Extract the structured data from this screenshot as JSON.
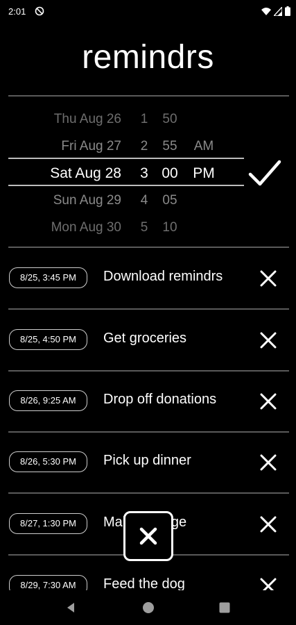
{
  "status_bar": {
    "time": "2:01",
    "icons": [
      "dnd-icon",
      "wifi-icon",
      "signal-icon",
      "battery-icon"
    ]
  },
  "app": {
    "title": "remindrs"
  },
  "picker": {
    "rows": [
      {
        "date": "Thu Aug 26",
        "hour": "1",
        "minute": "50",
        "ampm": ""
      },
      {
        "date": "Fri Aug 27",
        "hour": "2",
        "minute": "55",
        "ampm": "AM"
      },
      {
        "date": "Sat Aug 28",
        "hour": "3",
        "minute": "00",
        "ampm": "PM"
      },
      {
        "date": "Sun Aug 29",
        "hour": "4",
        "minute": "05",
        "ampm": ""
      },
      {
        "date": "Mon Aug 30",
        "hour": "5",
        "minute": "10",
        "ampm": ""
      }
    ],
    "confirm_icon": "check-icon"
  },
  "reminders": [
    {
      "time": "8/25, 3:45 PM",
      "text": "Download remindrs"
    },
    {
      "time": "8/25, 4:50 PM",
      "text": "Get groceries"
    },
    {
      "time": "8/26, 9:25 AM",
      "text": "Drop off donations"
    },
    {
      "time": "8/26, 5:30 PM",
      "text": "Pick up dinner"
    },
    {
      "time": "8/27, 1:30 PM",
      "text": "Make change"
    },
    {
      "time": "8/29, 7:30 AM",
      "text": "Feed the dog"
    }
  ],
  "fab": {
    "icon": "close-icon"
  },
  "nav": {
    "icons": [
      "back-icon",
      "home-icon",
      "recents-icon"
    ]
  },
  "colors": {
    "background": "#000000",
    "text": "#ffffff",
    "divider": "#5a5a5a",
    "dim_text": "#8a8a8a"
  }
}
